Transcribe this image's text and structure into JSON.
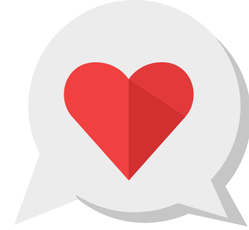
{
  "icon": {
    "name": "heart-chat-bubble-icon",
    "colors": {
      "background": "#ffffff",
      "bubble": "#ececec",
      "bubble_shadow": "#c6c6c6",
      "heart_light": "#f0403f",
      "heart_dark": "#d12f30",
      "heart_right": "#e23a3a"
    }
  }
}
